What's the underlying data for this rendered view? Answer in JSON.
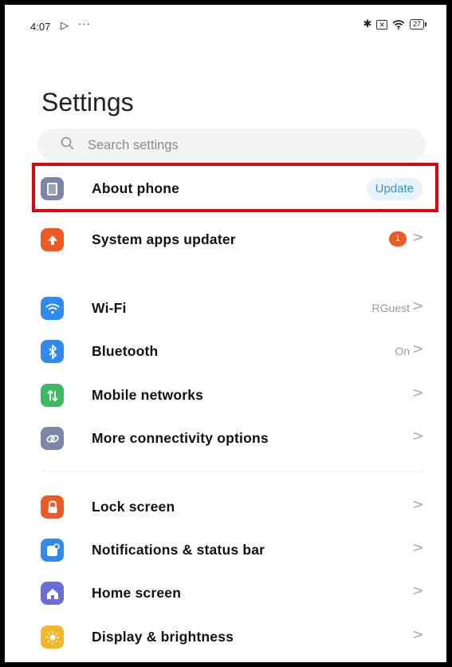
{
  "status_bar": {
    "time": "4:07",
    "battery": "27"
  },
  "title": "Settings",
  "search": {
    "placeholder": "Search settings"
  },
  "rows": [
    {
      "label": "About phone",
      "value": "",
      "action": "Update",
      "icon": "phone-icon",
      "color": "#7b86a8"
    },
    {
      "label": "System apps updater",
      "badge": "1",
      "icon": "arrow-up-icon",
      "color": "#ef5a24"
    },
    {
      "label": "Wi-Fi",
      "value": "RGuest",
      "icon": "wifi-icon",
      "color": "#2f8bf0"
    },
    {
      "label": "Bluetooth",
      "value": "On",
      "icon": "bluetooth-icon",
      "color": "#2f8bf0"
    },
    {
      "label": "Mobile networks",
      "value": "",
      "icon": "signal-icon",
      "color": "#3dbb63"
    },
    {
      "label": "More connectivity options",
      "value": "",
      "icon": "link-icon",
      "color": "#7b86a8"
    },
    {
      "label": "Lock screen",
      "value": "",
      "icon": "lock-icon",
      "color": "#ef5a24"
    },
    {
      "label": "Notifications & status bar",
      "value": "",
      "icon": "notification-icon",
      "color": "#2f8bf0"
    },
    {
      "label": "Home screen",
      "value": "",
      "icon": "home-icon",
      "color": "#6b6ed8"
    },
    {
      "label": "Display & brightness",
      "value": "",
      "icon": "sun-icon",
      "color": "#f5b72a"
    }
  ]
}
